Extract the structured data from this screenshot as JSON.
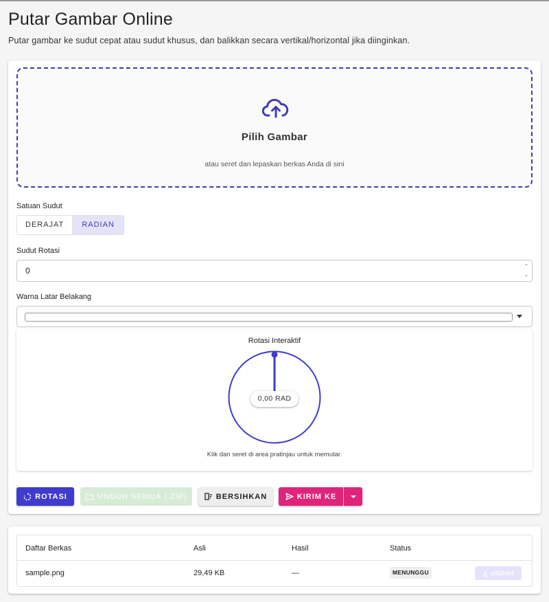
{
  "header": {
    "title": "Putar Gambar Online",
    "subtitle": "Putar gambar ke sudut cepat atau sudut khusus, dan balikkan secara vertikal/horizontal jika diinginkan."
  },
  "dropzone": {
    "icon": "cloud-upload-icon",
    "title": "Pilih Gambar",
    "subtitle": "atau seret dan lepaskan berkas Anda di sini"
  },
  "angle_unit": {
    "label": "Satuan Sudut",
    "options": [
      "DERAJAT",
      "RADIAN"
    ],
    "selected": "RADIAN"
  },
  "rotation_angle": {
    "label": "Sudut Rotasi",
    "value": "0"
  },
  "background_color": {
    "label": "Warna Latar Belakang",
    "value": "#ffffff"
  },
  "preview": {
    "title": "Rotasi Interaktif",
    "angle_display": "0,00 RAD",
    "hint": "Klik dan seret di area pratinjau untuk memutar."
  },
  "actions": {
    "rotate": "ROTASI",
    "download_all": "UNDUH SEMUA (.ZIP)",
    "clear": "BERSIHKAN",
    "send_to": "KIRIM KE"
  },
  "files_table": {
    "columns": [
      "Daftar Berkas",
      "Asli",
      "Hasil",
      "Status"
    ],
    "rows": [
      {
        "name": "sample.png",
        "original": "29,49 KB",
        "result": "—",
        "status": "MENUNGGU",
        "action": "UNDUH"
      }
    ]
  },
  "colors": {
    "primary": "#3f3bce",
    "accent": "#e0247b",
    "success_disabled": "#d6ecd7",
    "dropzone_border": "#3f3bb8"
  }
}
